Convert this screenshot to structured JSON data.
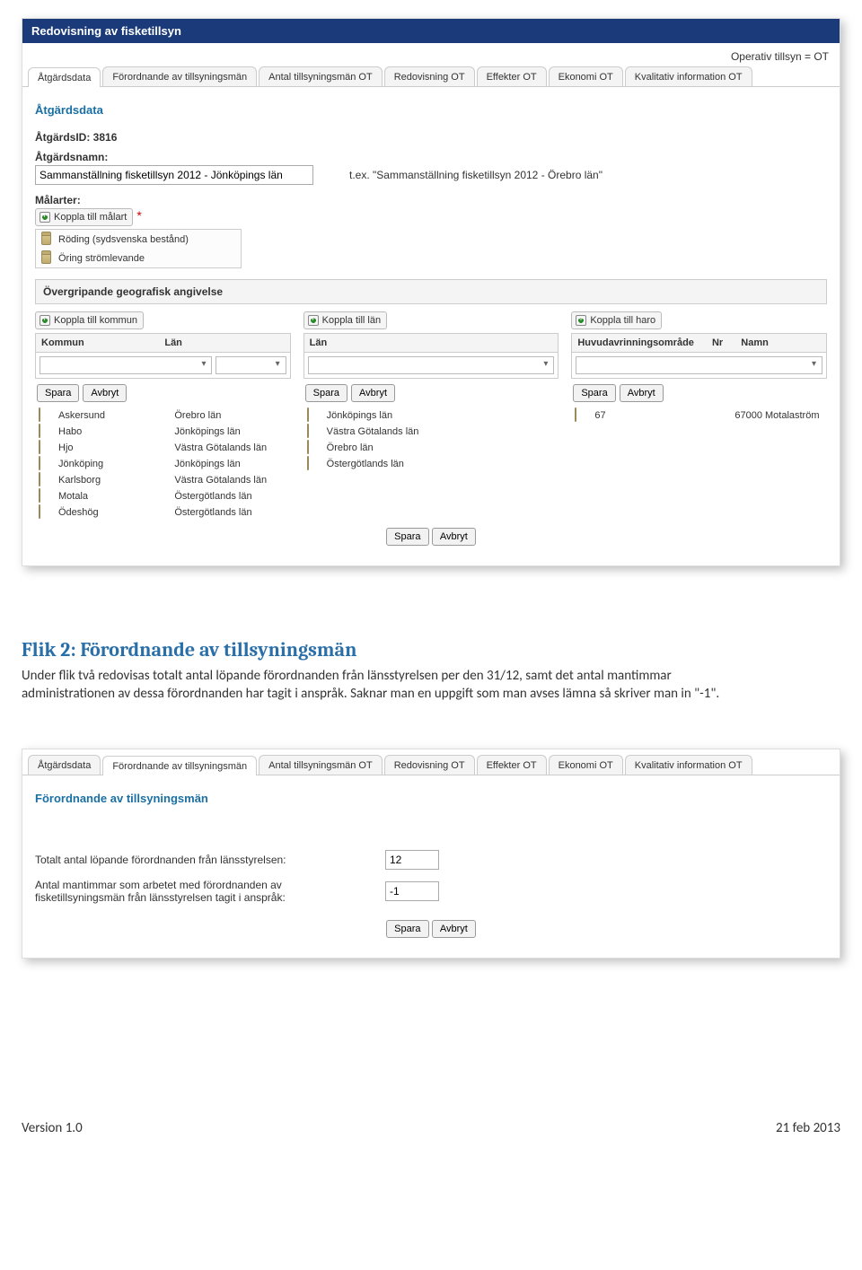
{
  "shot1": {
    "title": "Redovisning av fisketillsyn",
    "top_note": "Operativ tillsyn = OT",
    "tabs": [
      "Åtgärdsdata",
      "Förordnande av tillsyningsmän",
      "Antal tillsyningsmän OT",
      "Redovisning OT",
      "Effekter OT",
      "Ekonomi OT",
      "Kvalitativ information OT"
    ],
    "section": "Åtgärdsdata",
    "atgards_id_label": "ÅtgärdsID: 3816",
    "atgardsnamn_label": "Åtgärdsnamn:",
    "atgardsnamn_value": "Sammanställning fisketillsyn 2012 - Jönköpings län",
    "atgardsnamn_hint": "t.ex. \"Sammanställning fisketillsyn 2012 - Örebro län\"",
    "malarter_label": "Målarter:",
    "koppla_malart": "Koppla till målart",
    "malarter": [
      "Röding (sydsvenska bestånd)",
      "Öring strömlevande"
    ],
    "geo_header": "Övergripande geografisk angivelse",
    "koppla_kommun": "Koppla till kommun",
    "koppla_lan": "Koppla till län",
    "koppla_haro": "Koppla till haro",
    "col_kommun": "Kommun",
    "col_lan": "Län",
    "col_huvud": "Huvudavrinningsområde",
    "col_nr": "Nr",
    "col_namn": "Namn",
    "spara": "Spara",
    "avbryt": "Avbryt",
    "kommun_rows": [
      {
        "k": "Askersund",
        "l": "Örebro län"
      },
      {
        "k": "Habo",
        "l": "Jönköpings län"
      },
      {
        "k": "Hjo",
        "l": "Västra Götalands län"
      },
      {
        "k": "Jönköping",
        "l": "Jönköpings län"
      },
      {
        "k": "Karlsborg",
        "l": "Västra Götalands län"
      },
      {
        "k": "Motala",
        "l": "Östergötlands län"
      },
      {
        "k": "Ödeshög",
        "l": "Östergötlands län"
      }
    ],
    "lan_rows": [
      "Jönköpings län",
      "Västra Götalands län",
      "Örebro län",
      "Östergötlands län"
    ],
    "haro_rows": [
      {
        "h": "67",
        "nr": "",
        "n": "67000 Motalaström"
      }
    ]
  },
  "narrative": {
    "heading": "Flik 2: Förordnande av tillsyningsmän",
    "para": "Under flik två redovisas totalt antal löpande förordnanden från länsstyrelsen per den 31/12, samt det antal mantimmar administrationen av dessa förordnanden har tagit i anspråk. Saknar man en uppgift som man avses lämna så skriver man in \"-1\"."
  },
  "shot2": {
    "tabs": [
      "Åtgärdsdata",
      "Förordnande av tillsyningsmän",
      "Antal tillsyningsmän OT",
      "Redovisning OT",
      "Effekter OT",
      "Ekonomi OT",
      "Kvalitativ information OT"
    ],
    "section": "Förordnande av tillsyningsmän",
    "field1_label": "Totalt antal löpande förordnanden från länsstyrelsen:",
    "field1_value": "12",
    "field2_label": "Antal mantimmar som arbetet med förordnanden av fisketillsyningsmän från länsstyrelsen tagit i anspråk:",
    "field2_value": "-1",
    "spara": "Spara",
    "avbryt": "Avbryt"
  },
  "footer": {
    "left": "Version 1.0",
    "right": "21 feb 2013"
  }
}
